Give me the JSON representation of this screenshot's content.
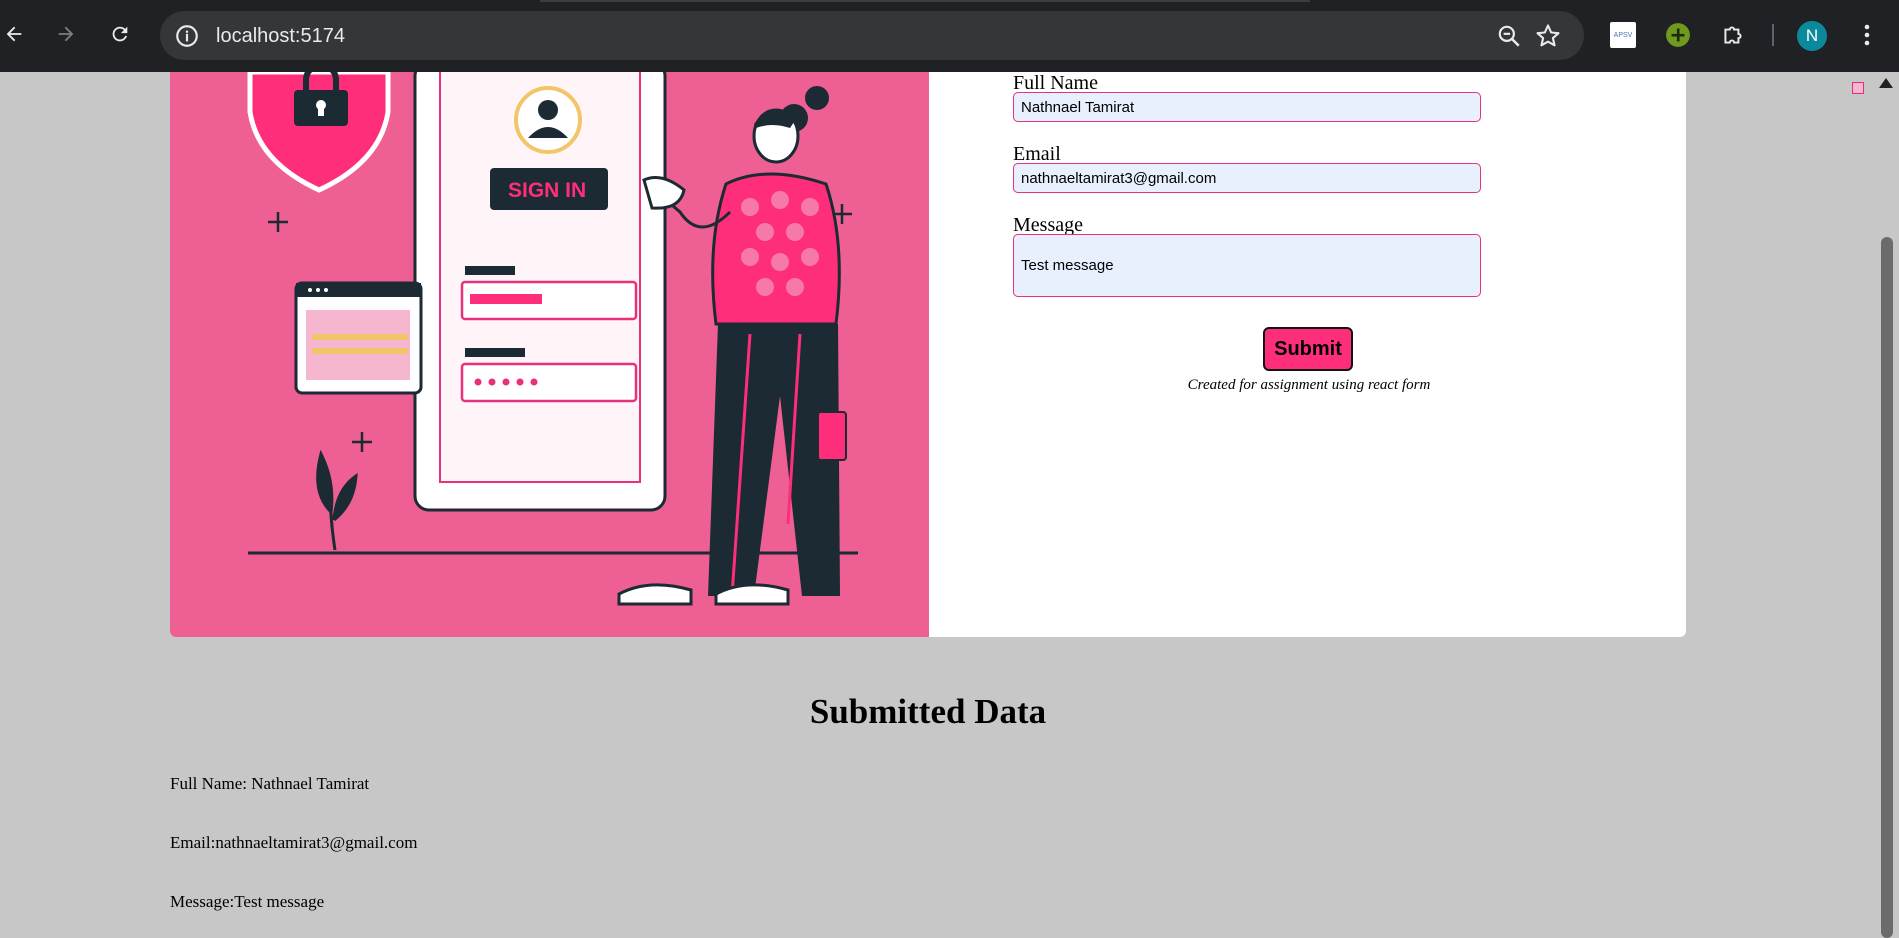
{
  "browser": {
    "url": "localhost:5174",
    "extension_apsv_label": "APSV",
    "profile_initial": "N"
  },
  "illustration": {
    "sign_in_label": "SIGN IN",
    "accent": "#ee5f93"
  },
  "form": {
    "full_name_label": "Full Name",
    "full_name_value": "Nathnael Tamirat",
    "email_label": "Email",
    "email_value": "nathnaeltamirat3@gmail.com",
    "message_label": "Message",
    "message_value": "Test message",
    "submit_label": "Submit",
    "credit": "Created for assignment using react form"
  },
  "submitted": {
    "title": "Submitted Data",
    "full_name_line": "Full Name: Nathnael Tamirat",
    "email_line": "Email:nathnaeltamirat3@gmail.com",
    "message_line": "Message:Test message"
  },
  "colors": {
    "brand_pink": "#ff2e7a",
    "field_border": "#e8317a",
    "field_bg": "#e8f0fe",
    "page_bg": "#c7c7c7"
  }
}
